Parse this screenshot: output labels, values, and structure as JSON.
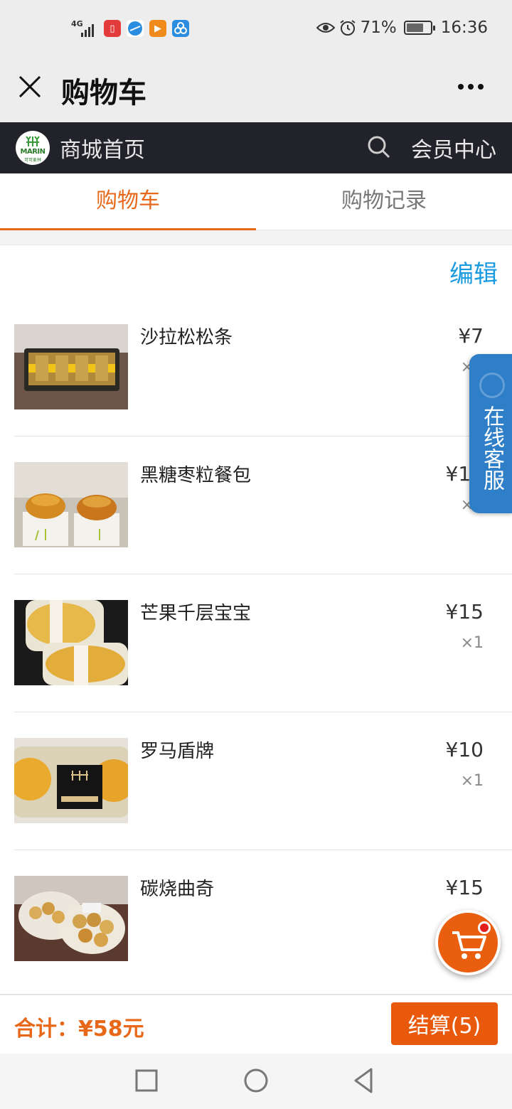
{
  "status_bar": {
    "network": "4G",
    "battery_percent": "71%",
    "time": "16:36",
    "battery_level": 0.71,
    "icons": [
      "signal-icon",
      "reader-app-icon",
      "browser-app-icon",
      "video-app-icon",
      "triangle-app-icon",
      "eye-icon",
      "alarm-icon",
      "battery-icon"
    ]
  },
  "title_bar": {
    "title": "购物车"
  },
  "store_nav": {
    "logo_text": "MARIN",
    "logo_sub": "可可麦林",
    "home": "商城首页",
    "member": "会员中心"
  },
  "tabs": [
    {
      "label": "购物车",
      "active": true
    },
    {
      "label": "购物记录",
      "active": false
    }
  ],
  "edit_label": "编辑",
  "cart_items": [
    {
      "name": "沙拉松松条",
      "price": "¥7",
      "qty": "×1"
    },
    {
      "name": "黑糖枣粒餐包",
      "price": "¥11",
      "qty": "×1"
    },
    {
      "name": "芒果千层宝宝",
      "price": "¥15",
      "qty": "×1"
    },
    {
      "name": "罗马盾牌",
      "price": "¥10",
      "qty": "×1"
    },
    {
      "name": "碳烧曲奇",
      "price": "¥15",
      "qty": "×1"
    }
  ],
  "service_label": "在线客服",
  "total": {
    "label": "合计：¥58元",
    "checkout": "结算(5)"
  },
  "colors": {
    "accent": "#e8681a",
    "checkout": "#e8590c",
    "link": "#1a9ae0",
    "service": "#2f7fc8",
    "nav_dark": "#22222a"
  }
}
